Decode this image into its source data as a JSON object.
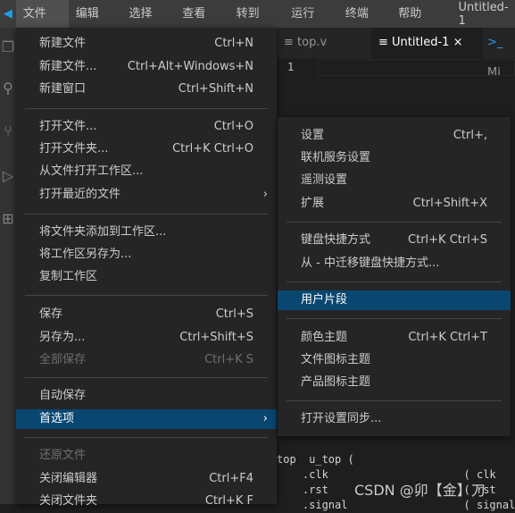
{
  "menubar": {
    "items": [
      "文件(F)",
      "编辑(E)",
      "选择(S)",
      "查看(V)",
      "转到(G)",
      "运行(R)",
      "终端(T)",
      "帮助(H)"
    ],
    "window_title": "Untitled-1"
  },
  "tabs": [
    {
      "label": "top.v",
      "icon": "file-icon"
    },
    {
      "label": "Untitled-1",
      "icon": "file-lines-icon",
      "active": true,
      "close": "×"
    },
    {
      "label": "Mi",
      "icon": "terminal-icon"
    }
  ],
  "editor": {
    "line_number": "1",
    "code": [
      "top  u_top (",
      "    .clk                     ( clk",
      "    .rst                     ( rst",
      "    .signal                  ( signal"
    ]
  },
  "watermark": "CSDN @卯【金】刀",
  "file_menu": [
    {
      "label": "新建文件",
      "key": "Ctrl+N"
    },
    {
      "label": "新建文件...",
      "key": "Ctrl+Alt+Windows+N"
    },
    {
      "label": "新建窗口",
      "key": "Ctrl+Shift+N"
    },
    {
      "label": "打开文件...",
      "key": "Ctrl+O"
    },
    {
      "label": "打开文件夹...",
      "key": "Ctrl+K Ctrl+O"
    },
    {
      "label": "从文件打开工作区...",
      "key": ""
    },
    {
      "label": "打开最近的文件",
      "key": "",
      "submenu": true
    },
    {
      "label": "将文件夹添加到工作区...",
      "key": ""
    },
    {
      "label": "将工作区另存为...",
      "key": ""
    },
    {
      "label": "复制工作区",
      "key": ""
    },
    {
      "label": "保存",
      "key": "Ctrl+S"
    },
    {
      "label": "另存为...",
      "key": "Ctrl+Shift+S"
    },
    {
      "label": "全部保存",
      "key": "Ctrl+K S",
      "disabled": true
    },
    {
      "label": "自动保存",
      "key": ""
    },
    {
      "label": "首选项",
      "key": "",
      "submenu": true,
      "selected": true
    },
    {
      "label": "还原文件",
      "key": "",
      "disabled": true
    },
    {
      "label": "关闭编辑器",
      "key": "Ctrl+F4"
    },
    {
      "label": "关闭文件夹",
      "key": "Ctrl+K F"
    }
  ],
  "pref_menu": [
    {
      "label": "设置",
      "key": "Ctrl+,"
    },
    {
      "label": "联机服务设置",
      "key": ""
    },
    {
      "label": "遥测设置",
      "key": ""
    },
    {
      "label": "扩展",
      "key": "Ctrl+Shift+X"
    },
    {
      "label": "键盘快捷方式",
      "key": "Ctrl+K Ctrl+S"
    },
    {
      "label": "从 - 中迁移键盘快捷方式...",
      "key": ""
    },
    {
      "label": "用户片段",
      "key": "",
      "selected": true
    },
    {
      "label": "颜色主题",
      "key": "Ctrl+K Ctrl+T"
    },
    {
      "label": "文件图标主题",
      "key": ""
    },
    {
      "label": "产品图标主题",
      "key": ""
    },
    {
      "label": "打开设置同步...",
      "key": ""
    }
  ],
  "submenu_arrow": "›"
}
